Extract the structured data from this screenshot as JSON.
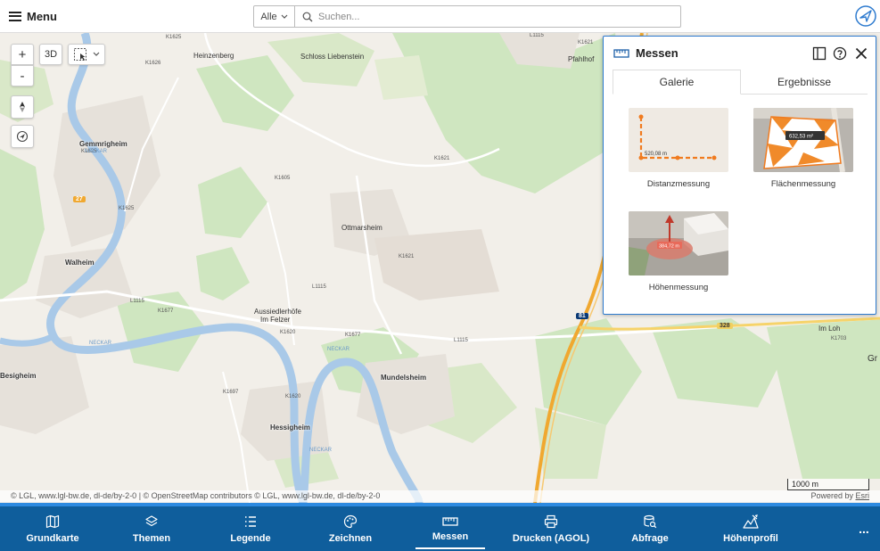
{
  "header": {
    "menu_label": "Menu",
    "search_scope": "Alle",
    "search_placeholder": "Suchen..."
  },
  "map": {
    "places": [
      "Heinzenberg",
      "Schloss Liebenstein",
      "Gemmrigheim",
      "Walheim",
      "Ottmarsheim",
      "Aussiedlerhöfe",
      "Im Felzer",
      "Mundelsheim",
      "Hessigheim",
      "Besigheim",
      "Pfahlhof",
      "Im Loh",
      "Gr"
    ],
    "roads": [
      "K1625",
      "K1626",
      "K1621",
      "K1605",
      "K1625",
      "K1625",
      "K1621",
      "L1115",
      "L1115",
      "K1677",
      "L1115",
      "K1620",
      "K1677",
      "K1697",
      "K1620",
      "K1703",
      "L1115",
      "K1621"
    ],
    "road_shields": [
      "27",
      "81",
      "328"
    ],
    "rivers": [
      "NECKAR",
      "NECKAR",
      "NECKAR",
      "NECKAR"
    ],
    "controls": {
      "zoom_in": "+",
      "zoom_out": "-",
      "view_3d": "3D"
    },
    "scale": "1000 m",
    "attribution_left": "© LGL, www.lgl-bw.de, dl-de/by-2-0 | © OpenStreetMap contributors © LGL, www.lgl-bw.de, dl-de/by-2-0",
    "attribution_right_prefix": "Powered by",
    "attribution_right_link": "Esri"
  },
  "panel": {
    "title": "Messen",
    "tabs": [
      "Galerie",
      "Ergebnisse"
    ],
    "items": [
      {
        "label": "Distanzmessung",
        "thumb_text": "520,08 m"
      },
      {
        "label": "Flächenmessung",
        "thumb_text": "632,53 m²"
      },
      {
        "label": "Höhenmessung",
        "thumb_text": "384,72 m"
      }
    ]
  },
  "bottom_nav": {
    "items": [
      {
        "label": "Grundkarte",
        "icon": "map-icon"
      },
      {
        "label": "Themen",
        "icon": "layers-icon"
      },
      {
        "label": "Legende",
        "icon": "list-icon"
      },
      {
        "label": "Zeichnen",
        "icon": "palette-icon"
      },
      {
        "label": "Messen",
        "icon": "ruler-icon"
      },
      {
        "label": "Drucken (AGOL)",
        "icon": "printer-icon"
      },
      {
        "label": "Abfrage",
        "icon": "query-icon"
      },
      {
        "label": "Höhenprofil",
        "icon": "elevation-profile-icon"
      }
    ],
    "more": "..."
  },
  "colors": {
    "accent": "#2e7bcf",
    "nav_bg": "#0f5e9c",
    "map_bg": "#f2efe9",
    "forest": "#cfe6c0",
    "river": "#a9c9e8",
    "motorway": "#f0a830"
  }
}
